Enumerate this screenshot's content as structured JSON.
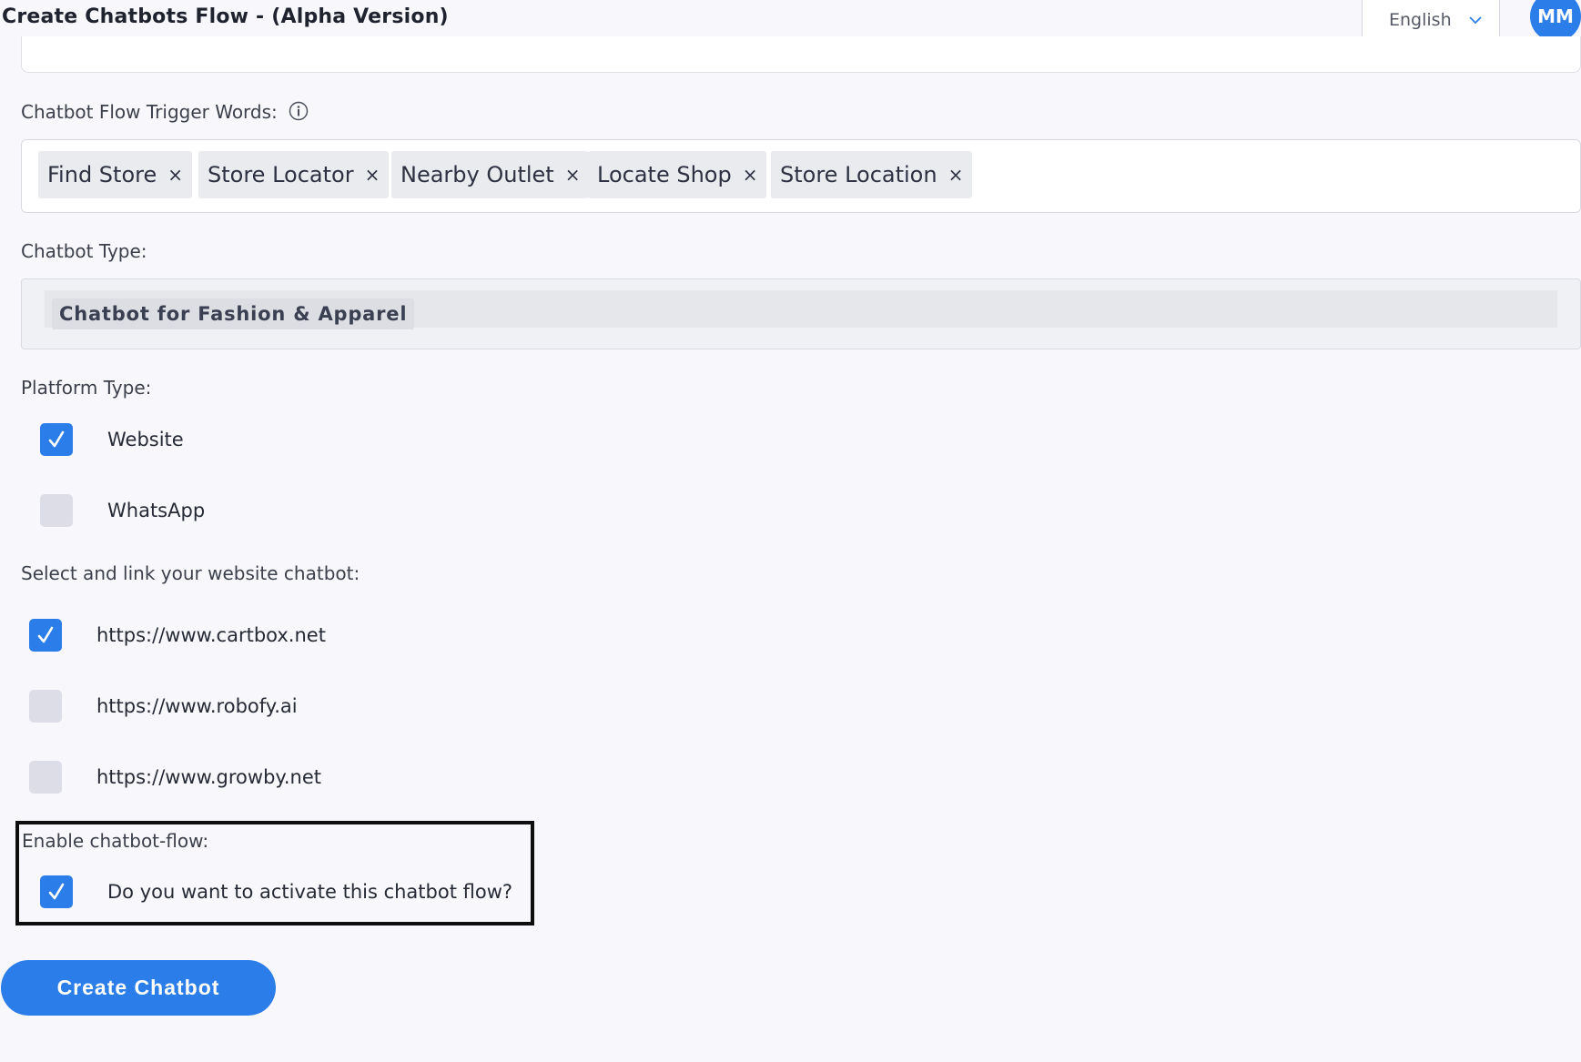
{
  "header": {
    "title": "Create Chatbots Flow - (Alpha Version)",
    "language": "English",
    "avatar_initials": "MM"
  },
  "trigger_words": {
    "label": "Chatbot Flow Trigger Words:",
    "tags": [
      "Find Store",
      "Store Locator",
      "Nearby Outlet",
      "Locate Shop",
      "Store Location"
    ],
    "remove_glyph": "×"
  },
  "chatbot_type": {
    "label": "Chatbot Type:",
    "value": "Chatbot for Fashion & Apparel"
  },
  "platform_type": {
    "label": "Platform Type:",
    "options": [
      {
        "label": "Website",
        "checked": true
      },
      {
        "label": "WhatsApp",
        "checked": false
      }
    ]
  },
  "website_link": {
    "label": "Select and link your website chatbot:",
    "options": [
      {
        "label": "https://www.cartbox.net",
        "checked": true
      },
      {
        "label": "https://www.robofy.ai",
        "checked": false
      },
      {
        "label": "https://www.growby.net",
        "checked": false
      }
    ]
  },
  "enable_flow": {
    "label": "Enable chatbot-flow:",
    "option_label": "Do you want to activate this chatbot flow?",
    "checked": true
  },
  "actions": {
    "create_label": "Create Chatbot"
  },
  "colors": {
    "accent": "#2b7de9",
    "background": "#f8f8fc",
    "unchecked": "#dcdde7"
  }
}
